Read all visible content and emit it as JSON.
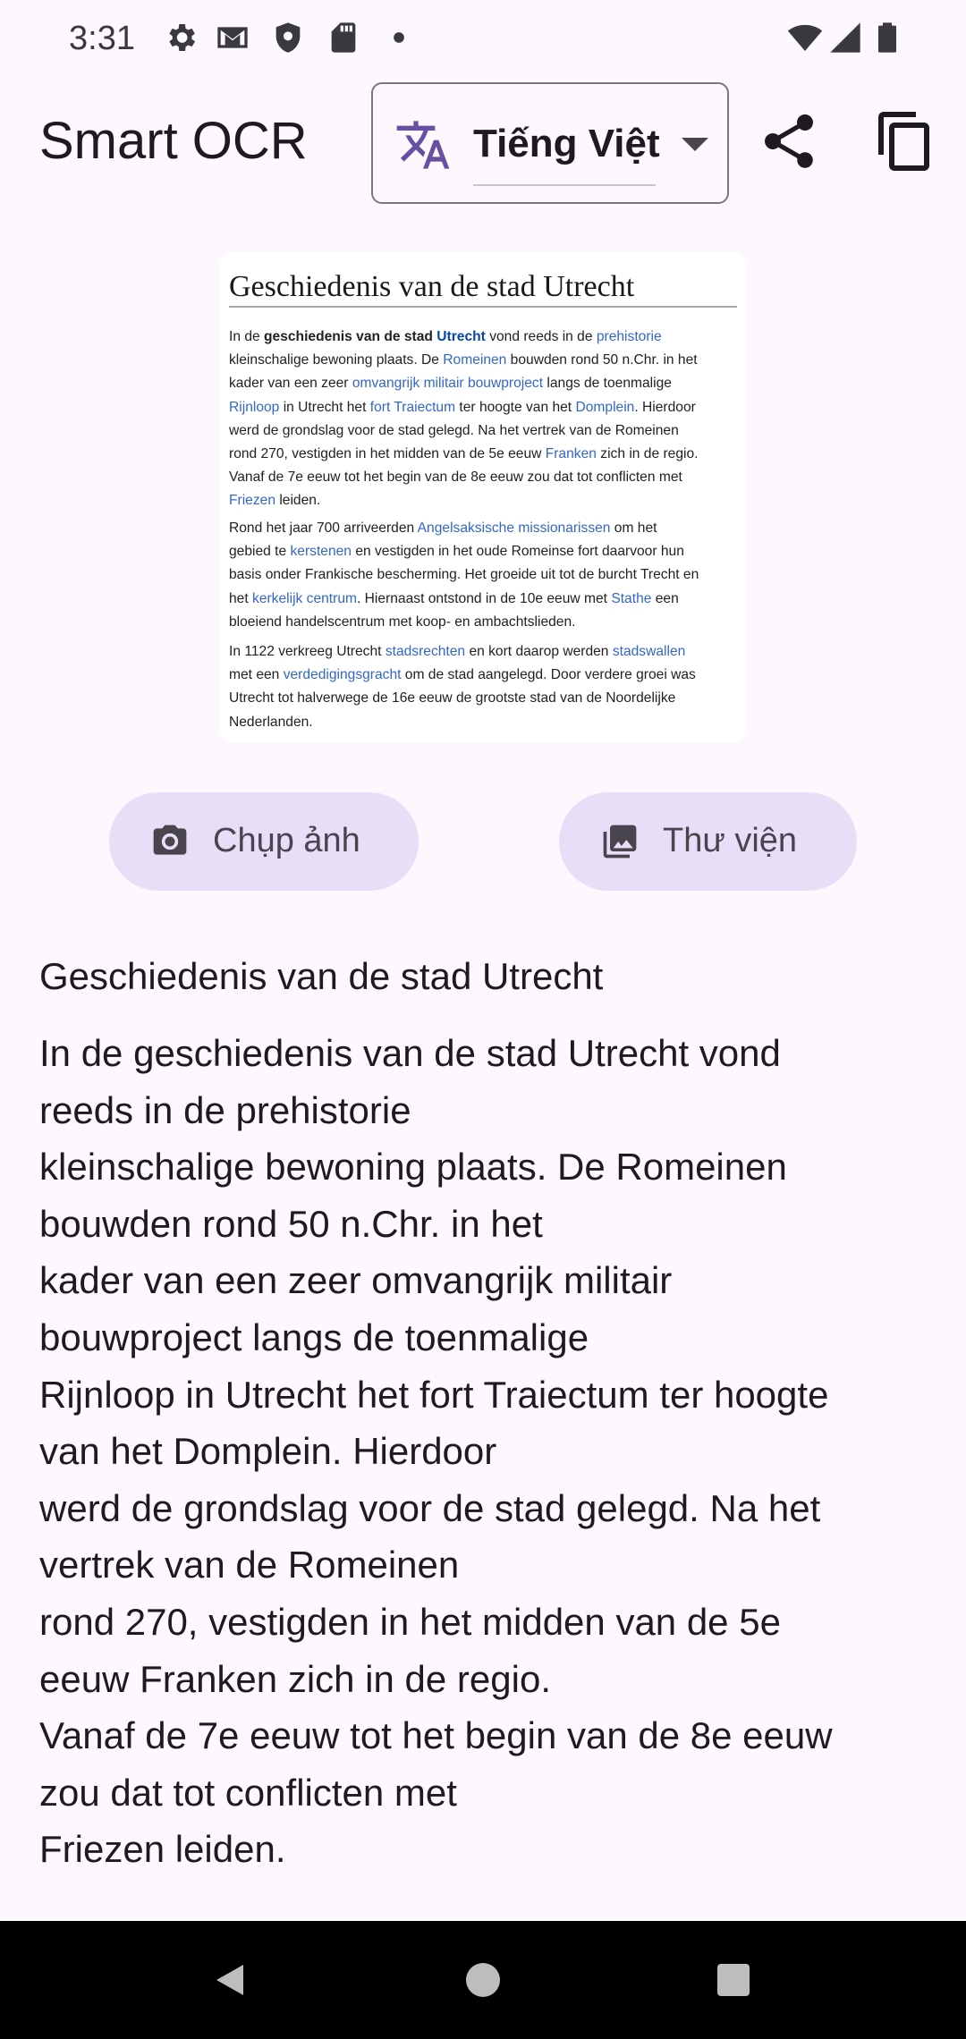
{
  "status_bar": {
    "time": "3:31",
    "icons": [
      "gear-icon",
      "gmail-icon",
      "shield-icon",
      "sd-card-icon",
      "dot-icon",
      "wifi-icon",
      "signal-icon",
      "battery-icon"
    ]
  },
  "app_bar": {
    "title": "Smart OCR",
    "language": "Tiếng Việt",
    "icons": [
      "translate-icon",
      "share-icon",
      "copy-icon"
    ]
  },
  "preview": {
    "heading": "Geschiedenis van de stad Utrecht",
    "p1": [
      [
        "In de ",
        "geschiedenis van de stad ",
        "Utrecht",
        " vond reeds in de ",
        "prehistorie"
      ],
      [
        "kleinschalige bewoning plaats. De ",
        "Romeinen",
        " bouwden rond 50 n.Chr. in het"
      ],
      [
        "kader van een zeer ",
        "omvangrijk militair bouwproject",
        " langs de toenmalige"
      ],
      [
        "Rijnloop",
        " in Utrecht het ",
        "fort Traiectum",
        " ter hoogte van het ",
        "Domplein",
        ". Hierdoor"
      ],
      [
        "werd de grondslag voor de stad gelegd. Na het vertrek van de Romeinen"
      ],
      [
        "rond 270, vestigden in het midden van de 5e eeuw ",
        "Franken",
        " zich in de regio."
      ],
      [
        "Vanaf de 7e eeuw tot het begin van de 8e eeuw zou dat tot conflicten met"
      ],
      [
        "Friezen",
        " leiden."
      ]
    ],
    "p2": [
      [
        "Rond het jaar 700 arriveerden ",
        "Angelsaksische missionarissen",
        " om het"
      ],
      [
        "gebied te ",
        "kerstenen",
        " en vestigden in het oude Romeinse fort daarvoor hun"
      ],
      [
        "basis onder Frankische bescherming. Het groeide uit tot de burcht Trecht en"
      ],
      [
        "het ",
        "kerkelijk centrum",
        ". Hiernaast ontstond in de 10e eeuw met ",
        "Stathe",
        " een"
      ],
      [
        "bloeiend handelscentrum met koop- en ambachtslieden."
      ]
    ],
    "p3": [
      [
        "In 1122 verkreeg Utrecht ",
        "stadsrechten",
        " en kort daarop werden ",
        "stadswallen"
      ],
      [
        "met een ",
        "verdedigingsgracht",
        " om de stad aangelegd. Door verdere groei was"
      ],
      [
        "Utrecht tot halverwege de 16e eeuw de grootste stad van de Noordelijke"
      ],
      [
        "Nederlanden."
      ]
    ]
  },
  "buttons": {
    "camera_label": "Chụp ảnh",
    "gallery_label": "Thư viện"
  },
  "result": {
    "title": "Geschiedenis van de stad Utrecht",
    "lines": [
      "In de geschiedenis van de stad Utrecht vond",
      "reeds in de prehistorie",
      "kleinschalige bewoning plaats. De Romeinen",
      "bouwden rond 50 n.Chr. in het",
      "kader van een zeer omvangrijk militair",
      "bouwproject langs de toenmalige",
      "Rijnloop in Utrecht het fort Traiectum ter hoogte",
      "van het Domplein. Hierdoor",
      "werd de grondslag voor de stad gelegd. Na het",
      "vertrek van de Romeinen",
      "rond 270, vestigden in het midden van de 5e",
      "eeuw Franken zich in de regio.",
      "Vanaf de 7e eeuw tot het begin van de 8e eeuw",
      "zou dat tot conflicten met",
      "Friezen leiden."
    ]
  },
  "nav_bar": {
    "icons": [
      "back-icon",
      "home-icon",
      "recents-icon"
    ]
  },
  "colors": {
    "background": "#fdf7fe",
    "button_fill": "#e8def8",
    "accent": "#6750a4",
    "link": "#3366cc"
  }
}
